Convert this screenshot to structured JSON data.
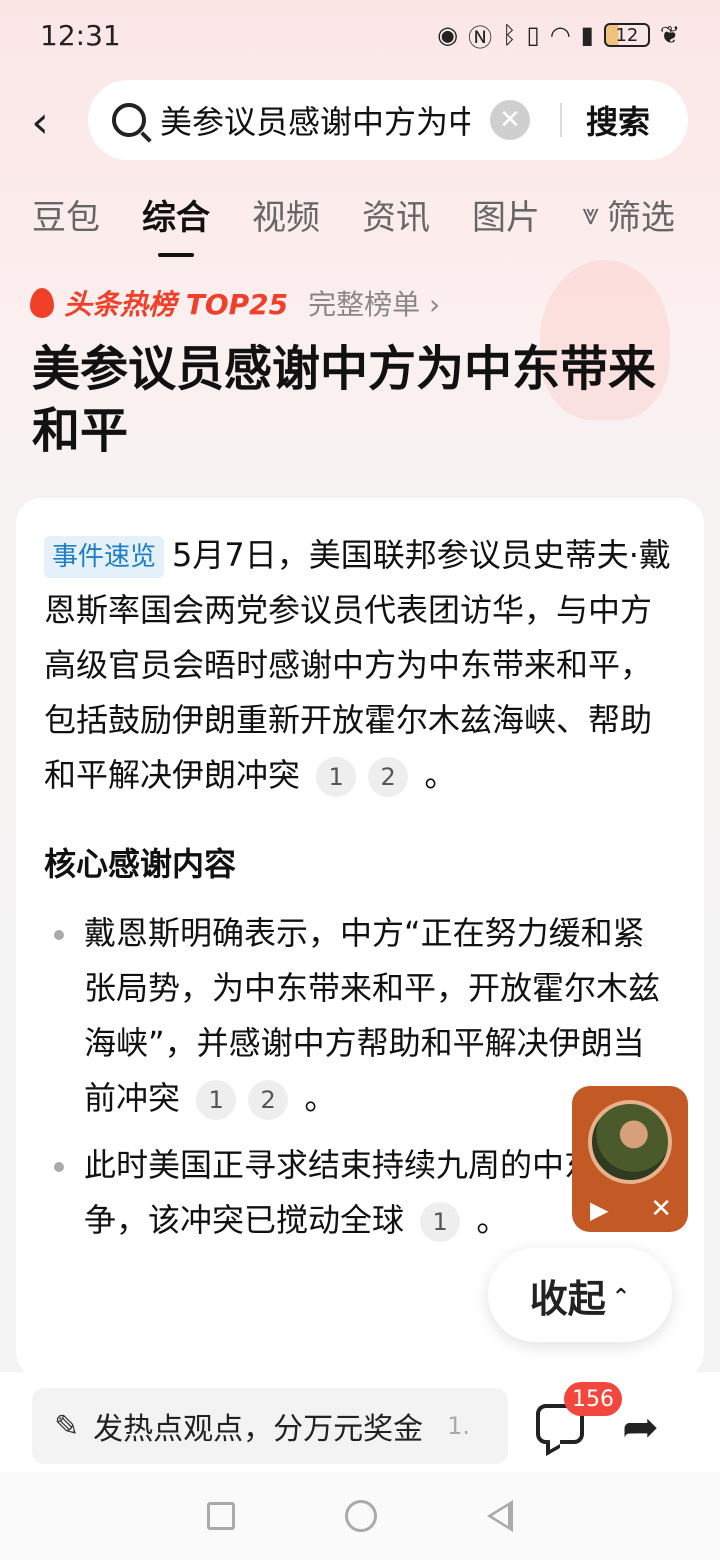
{
  "status": {
    "time": "12:31",
    "battery": "12"
  },
  "search": {
    "query": "美参议员感谢中方为中东带来和平",
    "button": "搜索"
  },
  "tabs": [
    "豆包",
    "综合",
    "视频",
    "资讯",
    "图片",
    "筛选"
  ],
  "active_tab": "综合",
  "hot": {
    "label": "头条热榜 TOP25",
    "link": "完整榜单 ›"
  },
  "headline": "美参议员感谢中方为中东带来和平",
  "card": {
    "tag": "事件速览",
    "summary": "5月7日，美国联邦参议员史蒂夫·戴恩斯率国会两党参议员代表团访华，与中方高级官员会晤时感谢中方为中东带来和平，包括鼓励伊朗重新开放霍尔木兹海峡、帮助和平解决伊朗冲突",
    "refs": [
      "1",
      "2"
    ],
    "section_title": "核心感谢内容",
    "bullets": [
      {
        "text": "戴恩斯明确表示，中方“正在努力缓和紧张局势，为中东带来和平，开放霍尔木兹海峡”，并感谢中方帮助和平解决伊朗当前冲突",
        "refs": [
          "1",
          "2"
        ]
      },
      {
        "text": "此时美国正寻求结束持续九周的中东战争，该冲突已搅动全球",
        "refs": [
          "1"
        ]
      }
    ]
  },
  "collapse_label": "收起",
  "bottom": {
    "comment_placeholder": "发热点观点，分万元奖金",
    "more": "1.",
    "comment_count": "156"
  }
}
